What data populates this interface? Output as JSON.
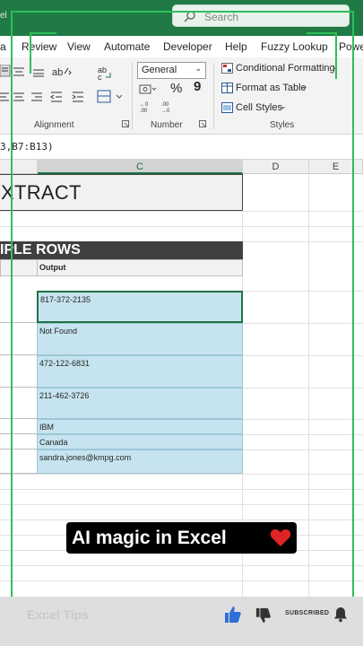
{
  "window": {
    "title_fragment": "el"
  },
  "search": {
    "placeholder": "Search"
  },
  "tabs": [
    {
      "label": "a"
    },
    {
      "label": "Review"
    },
    {
      "label": "View"
    },
    {
      "label": "Automate"
    },
    {
      "label": "Developer"
    },
    {
      "label": "Help"
    },
    {
      "label": "Fuzzy Lookup"
    },
    {
      "label": "Powe"
    }
  ],
  "ribbon": {
    "alignment_label": "Alignment",
    "number_label": "Number",
    "styles_label": "Styles",
    "number_format": "General",
    "currency_symbol": "$",
    "percent_symbol": "%",
    "comma_symbol": "9",
    "conditional_formatting": "Conditional Formatting",
    "format_as_table": "Format as Table",
    "cell_styles": "Cell Styles"
  },
  "formula_bar": {
    "text": "3,B7:B13)"
  },
  "columns": [
    "C",
    "D",
    "E"
  ],
  "sheet": {
    "title": "XTRACT",
    "banner": "IPLE ROWS",
    "output_header": "Output",
    "outputs": [
      "817-372-2135",
      "Not Found",
      "472-122-6831",
      "211-462-3726",
      "IBM",
      "Canada",
      "sandra.jones@kmpg.com"
    ]
  },
  "overlay": {
    "caption": "AI magic in Excel",
    "heart_icon": "red-heart-icon",
    "subscribed_label": "SUBSCRIBED",
    "blurred_text": "Excel Tips"
  },
  "colors": {
    "excel_green": "#1f7a45",
    "output_fill": "#c6e4ef",
    "banner_fill": "#404040",
    "overlay_outline": "#2fbf5a"
  }
}
